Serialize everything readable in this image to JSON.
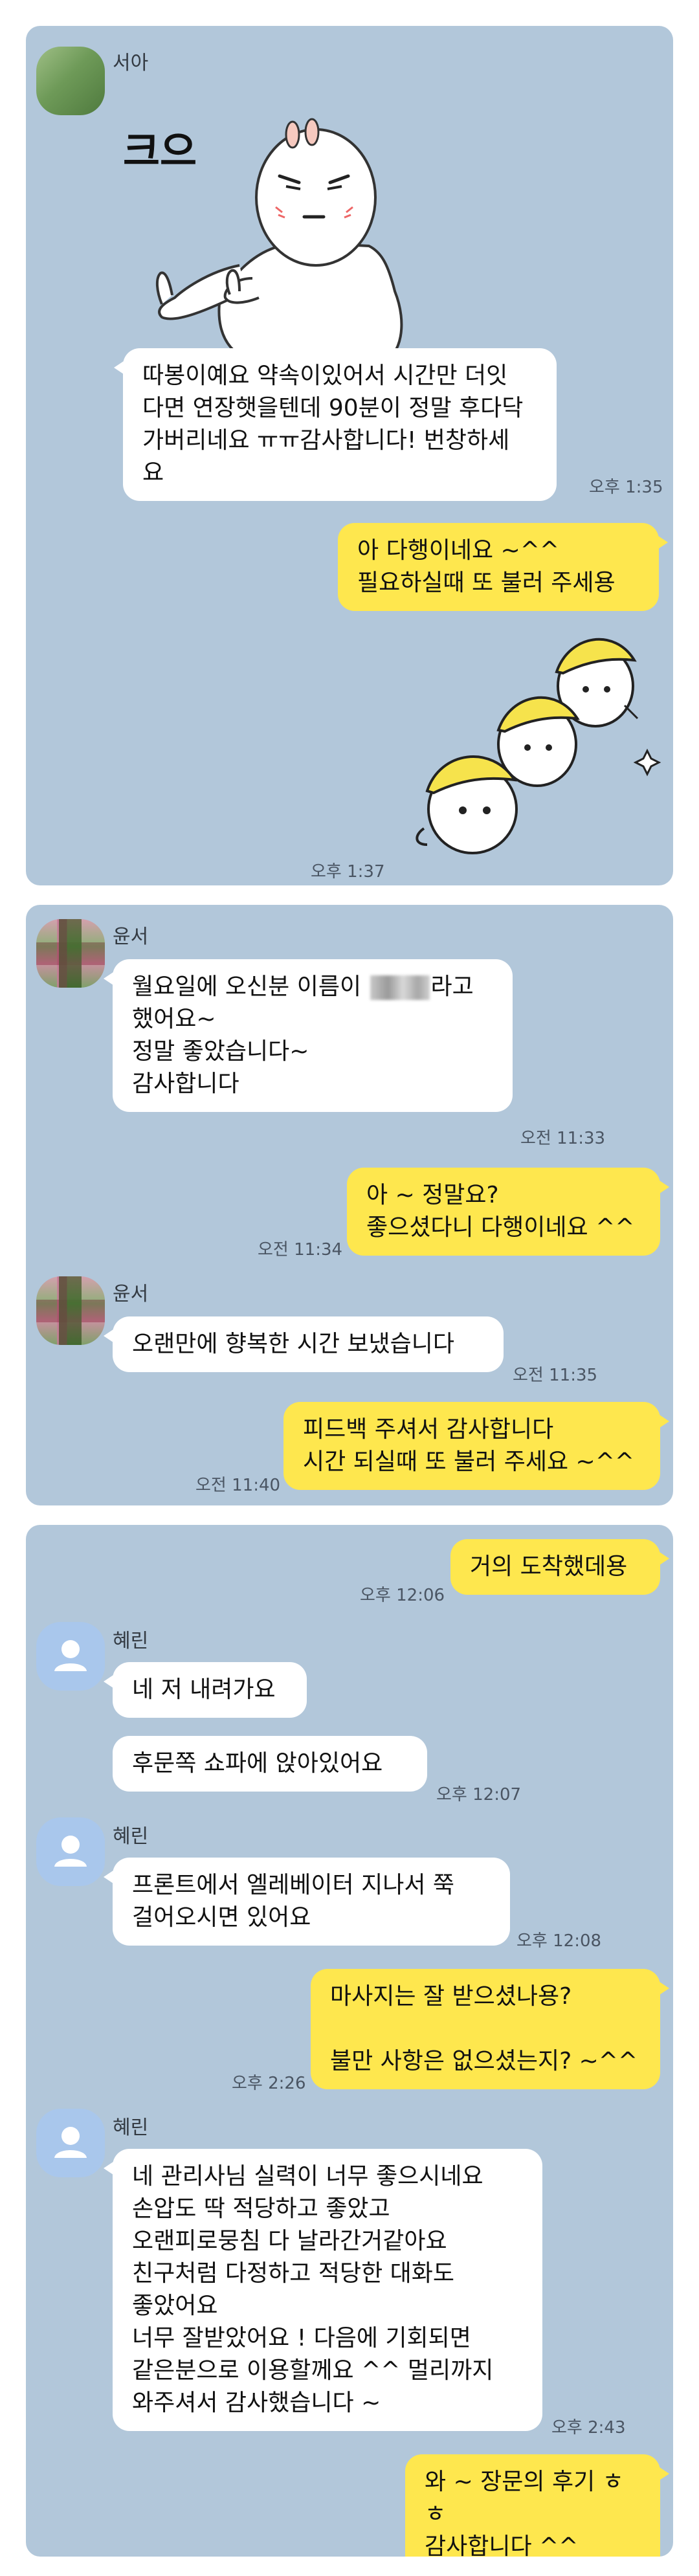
{
  "colors": {
    "chat_background": "#b2c7da",
    "incoming_bubble": "#ffffff",
    "outgoing_bubble": "#fee74e"
  },
  "chat1": {
    "sender": "서아",
    "sticker_text": "크으",
    "msg1": "따봉이예요 약속이있어서 시간만 더잇\n다면 연장햇을텐데 90분이 정말 후다닥\n가버리네요 ㅠㅠ감사합니다! 번창하세\n요",
    "msg1_time": "오후 1:35",
    "reply1": "아 다행이네요 ~^^\n필요하실때 또 불러 주세용",
    "reply_sticker_time": "오후 1:37"
  },
  "chat2": {
    "sender1": "윤서",
    "msg1_a": "월요일에 오신분 이름이 ",
    "msg1_b": "라고\n했어요~\n정말 좋았습니다~\n감사합니다",
    "msg1_time": "오전 11:33",
    "reply1": "아 ~ 정말요?\n좋으셨다니 다행이네요 ^^",
    "reply1_time": "오전 11:34",
    "sender2": "윤서",
    "msg2": "오랜만에 향복한 시간 보냈습니다",
    "msg2_time": "오전 11:35",
    "reply2": "피드백 주셔서 감사합니다\n시간 되실때 또 불러 주세요 ~^^",
    "reply2_time": "오전 11:40"
  },
  "chat3": {
    "out1": "거의 도착했데용",
    "out1_time": "오후 12:06",
    "sender1": "혜린",
    "in1": "네 저 내려가요",
    "in2": "후문쪽 쇼파에 앉아있어요",
    "in2_time": "오후 12:07",
    "sender2": "혜린",
    "in3": "프론트에서 엘레베이터 지나서 쭉\n걸어오시면 있어요",
    "in3_time": "오후 12:08",
    "out2": "마사지는 잘 받으셨나용?\n\n불만 사항은 없으셨는지? ~^^",
    "out2_time": "오후 2:26",
    "sender3": "혜린",
    "in4": "네 관리사님 실력이 너무 좋으시네요\n손압도 딱 적당하고 좋았고\n오랜피로뭉침 다 날라간거같아요\n친구처럼 다정하고 적당한 대화도\n좋았어요\n너무 잘받았어요 ! 다음에 기회되면\n같은분으로 이용할께요 ^^ 멀리까지\n와주셔서 감사했습니다 ~",
    "in4_time": "오후 2:43",
    "out3": "와 ~ 장문의 후기 ㅎㅎ\n감사합니다 ^^"
  }
}
